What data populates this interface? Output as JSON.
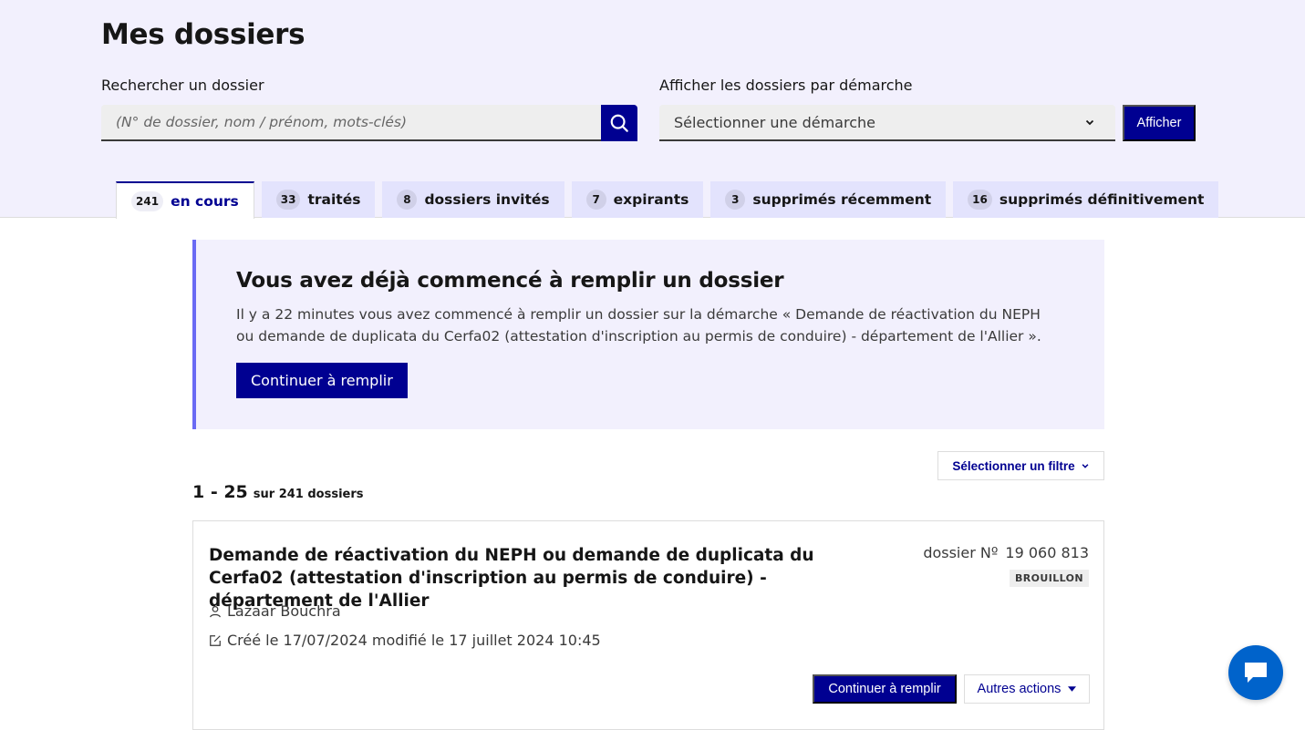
{
  "page": {
    "title": "Mes dossiers"
  },
  "search": {
    "label": "Rechercher un dossier",
    "placeholder": "(N° de dossier, nom / prénom, mots-clés)",
    "value": ""
  },
  "procedure_filter": {
    "label": "Afficher les dossiers par démarche",
    "selected": "Sélectionner une démarche",
    "button_label": "Afficher"
  },
  "tabs": [
    {
      "count": "241",
      "label": "en cours",
      "active": true
    },
    {
      "count": "33",
      "label": "traités"
    },
    {
      "count": "8",
      "label": "dossiers invités"
    },
    {
      "count": "7",
      "label": "expirants"
    },
    {
      "count": "3",
      "label": "supprimés récemment"
    },
    {
      "count": "16",
      "label": "supprimés définitivement"
    }
  ],
  "callout": {
    "title": "Vous avez déjà commencé à remplir un dossier",
    "text": "Il y a 22 minutes vous avez commencé à remplir un dossier sur la démarche « Demande de réactivation du NEPH ou demande de duplicata du Cerfa02 (attestation d'inscription au permis de conduire) - département de l'Allier ».",
    "button_label": "Continuer à remplir"
  },
  "list": {
    "filter_label": "Sélectionner un filtre",
    "range": "1 - 25",
    "total": "sur 241 dossiers"
  },
  "dossier": {
    "title": "Demande de réactivation du NEPH ou demande de duplicata du Cerfa02 (attestation d'inscription au permis de conduire) - département de l'Allier",
    "number_label": "dossier Nº",
    "number": "19 060 813",
    "status": "BROUILLON",
    "user": "Lazaar Bouchra",
    "dates": "Créé le 17/07/2024 modifié le 17 juillet 2024 10:45",
    "primary_action": "Continuer à remplir",
    "secondary_action": "Autres actions"
  },
  "colors": {
    "primary": "#000091",
    "tab_bg": "#e3e3fd",
    "header_bg": "#f2f0fd",
    "callout_border": "#6a6af4",
    "chat": "#0063cb"
  },
  "icons": [
    "search-icon",
    "chevron-down-icon",
    "user-icon",
    "edit-icon",
    "chat-icon"
  ]
}
